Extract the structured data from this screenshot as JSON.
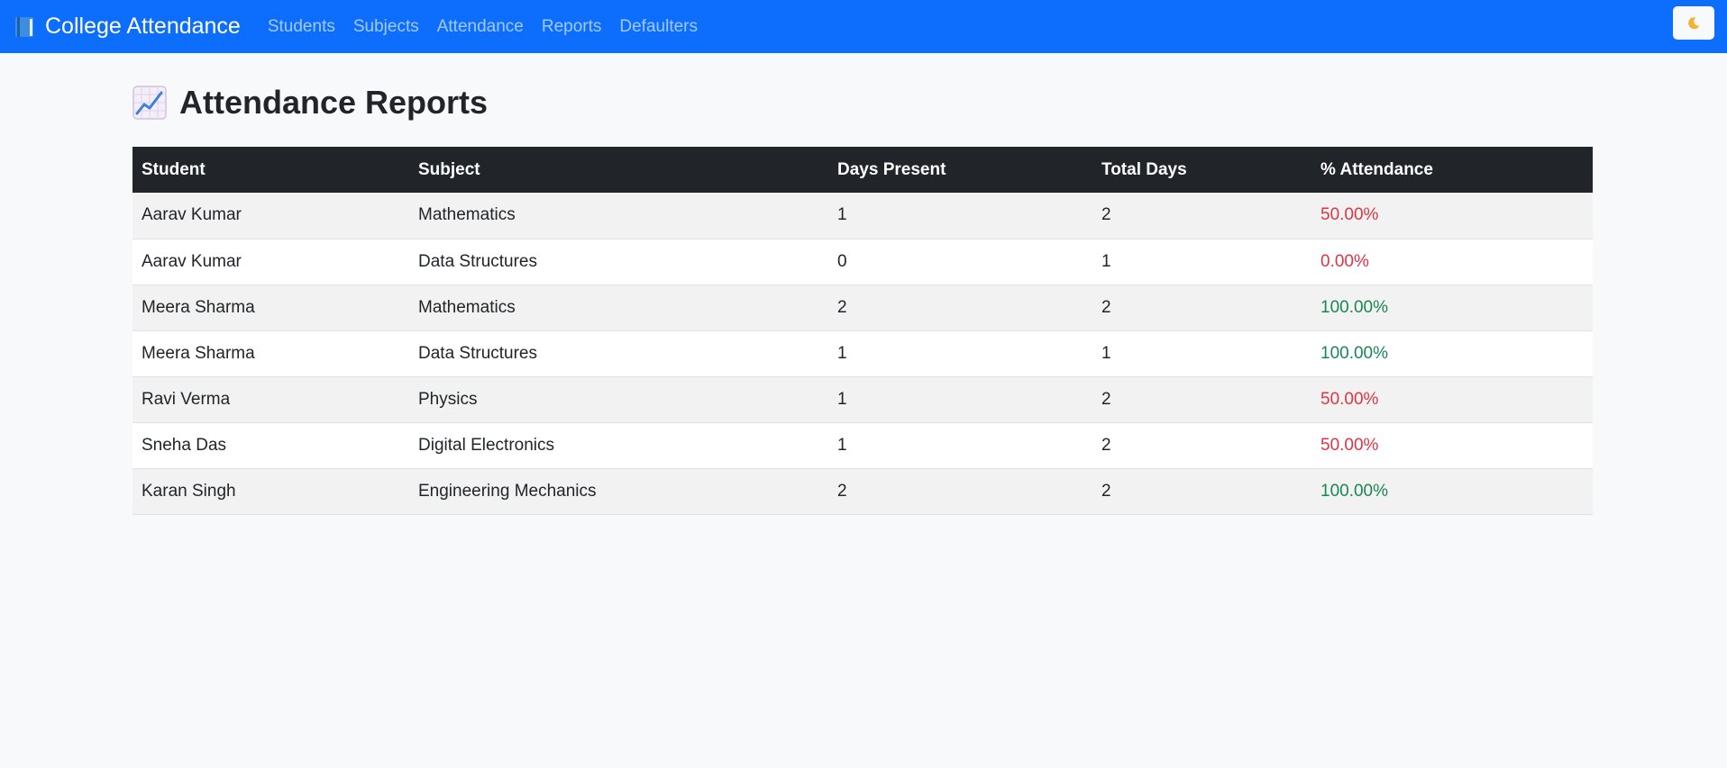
{
  "navbar": {
    "brand": "College Attendance",
    "links": [
      "Students",
      "Subjects",
      "Attendance",
      "Reports",
      "Defaulters"
    ],
    "theme_toggle_icon": "moon-icon"
  },
  "page": {
    "title": "Attendance Reports",
    "title_icon": "chart-increasing-icon"
  },
  "table": {
    "headers": [
      "Student",
      "Subject",
      "Days Present",
      "Total Days",
      "% Attendance"
    ],
    "rows": [
      {
        "student": "Aarav Kumar",
        "subject": "Mathematics",
        "present": "1",
        "total": "2",
        "pct": "50.00%",
        "status": "low"
      },
      {
        "student": "Aarav Kumar",
        "subject": "Data Structures",
        "present": "0",
        "total": "1",
        "pct": "0.00%",
        "status": "low"
      },
      {
        "student": "Meera Sharma",
        "subject": "Mathematics",
        "present": "2",
        "total": "2",
        "pct": "100.00%",
        "status": "high"
      },
      {
        "student": "Meera Sharma",
        "subject": "Data Structures",
        "present": "1",
        "total": "1",
        "pct": "100.00%",
        "status": "high"
      },
      {
        "student": "Ravi Verma",
        "subject": "Physics",
        "present": "1",
        "total": "2",
        "pct": "50.00%",
        "status": "low"
      },
      {
        "student": "Sneha Das",
        "subject": "Digital Electronics",
        "present": "1",
        "total": "2",
        "pct": "50.00%",
        "status": "low"
      },
      {
        "student": "Karan Singh",
        "subject": "Engineering Mechanics",
        "present": "2",
        "total": "2",
        "pct": "100.00%",
        "status": "high"
      }
    ]
  },
  "colors": {
    "navbar": "#0d6efd",
    "low": "#dc3545",
    "high": "#198754",
    "table_header": "#212529"
  }
}
